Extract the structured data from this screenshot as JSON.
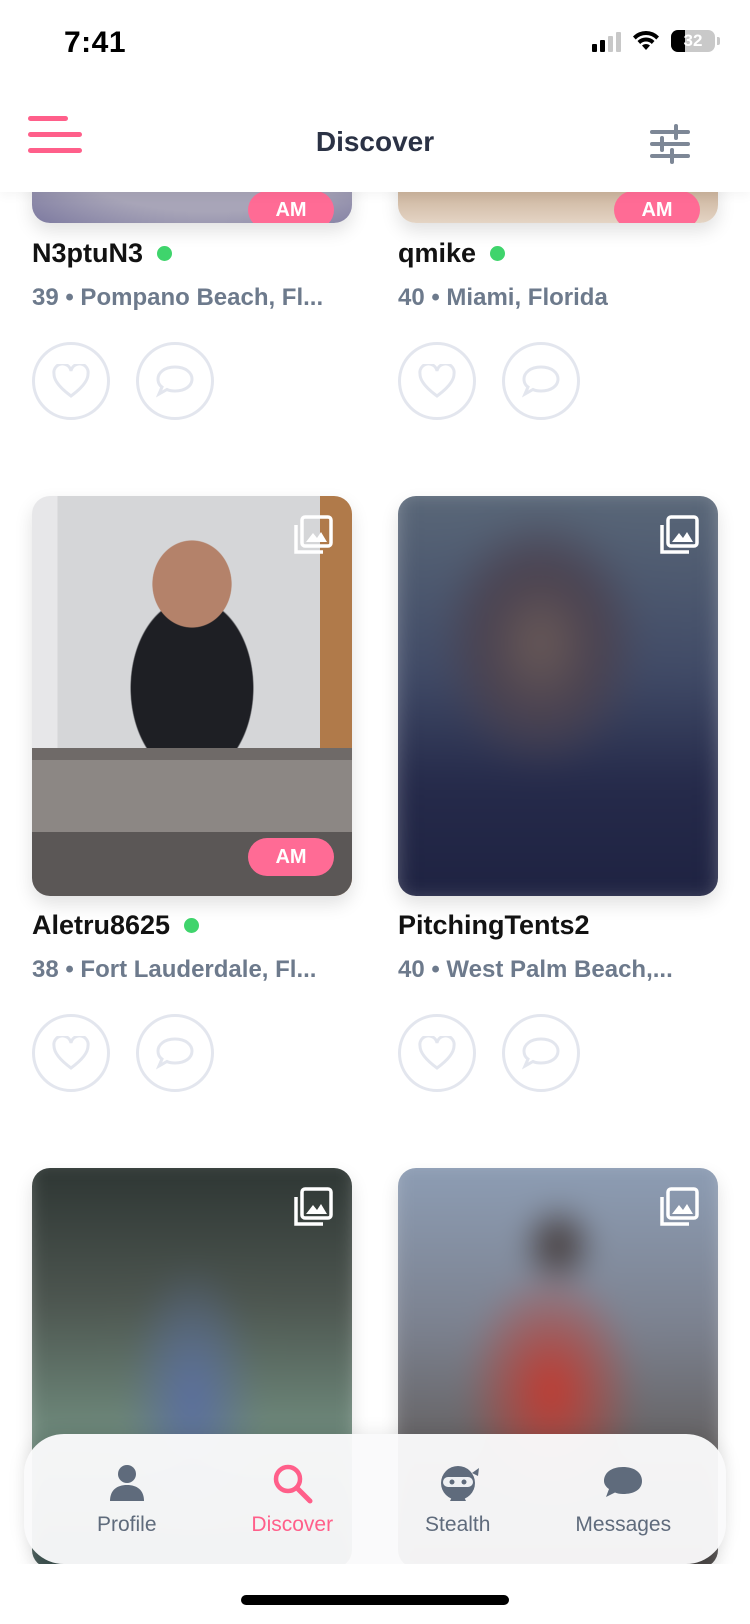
{
  "status_bar": {
    "time": "7:41",
    "battery": "32"
  },
  "header": {
    "title": "Discover"
  },
  "profiles": [
    {
      "username": "N3ptuN3",
      "meta": "39 • Pompano Beach, Fl...",
      "online": true,
      "badge": "AM"
    },
    {
      "username": "qmike",
      "meta": "40 • Miami, Florida",
      "online": true,
      "badge": "AM"
    },
    {
      "username": "Aletru8625",
      "meta": "38 • Fort Lauderdale, Fl...",
      "online": true,
      "badge": "AM"
    },
    {
      "username": "PitchingTents2",
      "meta": "40 • West Palm Beach,...",
      "online": false,
      "badge": ""
    }
  ],
  "tabs": [
    {
      "label": "Profile",
      "icon": "person-icon"
    },
    {
      "label": "Discover",
      "icon": "search-icon",
      "active": true
    },
    {
      "label": "Stealth",
      "icon": "ninja-icon"
    },
    {
      "label": "Messages",
      "icon": "chat-bubble-icon"
    }
  ],
  "colors": {
    "accent": "#ff5f8a",
    "badge": "#ff6b95",
    "online": "#3fd46c",
    "muted": "#6d7a8c"
  }
}
